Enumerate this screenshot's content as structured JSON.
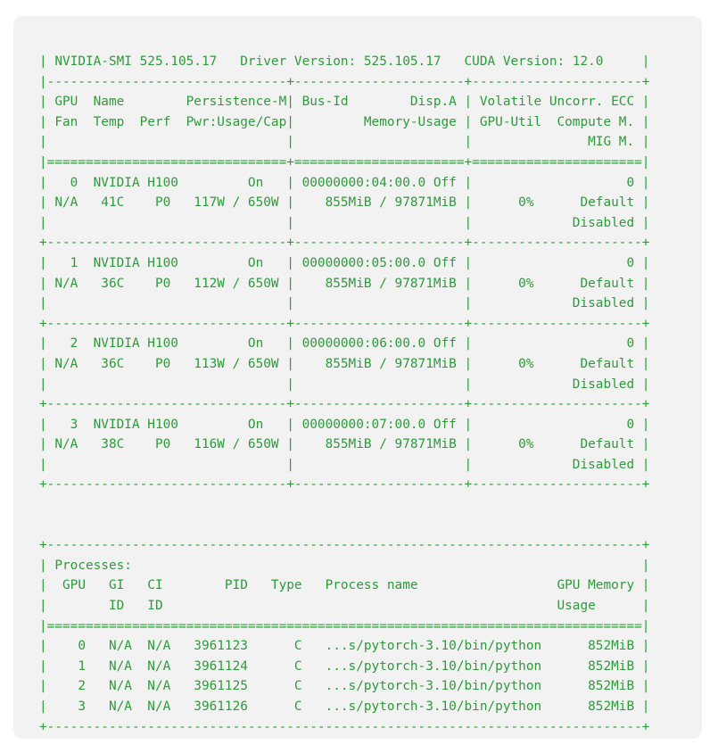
{
  "smi": {
    "version_line": "| NVIDIA-SMI 525.105.17   Driver Version: 525.105.17   CUDA Version: 12.0     |",
    "gpu_table": {
      "top_border": "|-------------------------------+----------------------+----------------------+",
      "header_rows": [
        "| GPU  Name        Persistence-M| Bus-Id        Disp.A | Volatile Uncorr. ECC |",
        "| Fan  Temp  Perf  Pwr:Usage/Cap|         Memory-Usage | GPU-Util  Compute M. |",
        "|                               |                      |               MIG M. |"
      ],
      "header_separator": "|===============================+======================+======================|",
      "gpus": [
        {
          "rows": [
            "|   0  NVIDIA H100         On   | 00000000:04:00.0 Off |                    0 |",
            "| N/A   41C    P0   117W / 650W |    855MiB / 97871MiB |      0%      Default |",
            "|                               |                      |             Disabled |"
          ],
          "separator": "+-------------------------------+----------------------+----------------------+"
        },
        {
          "rows": [
            "|   1  NVIDIA H100         On   | 00000000:05:00.0 Off |                    0 |",
            "| N/A   36C    P0   112W / 650W |    855MiB / 97871MiB |      0%      Default |",
            "|                               |                      |             Disabled |"
          ],
          "separator": "+-------------------------------+----------------------+----------------------+"
        },
        {
          "rows": [
            "|   2  NVIDIA H100         On   | 00000000:06:00.0 Off |                    0 |",
            "| N/A   36C    P0   113W / 650W |    855MiB / 97871MiB |      0%      Default |",
            "|                               |                      |             Disabled |"
          ],
          "separator": "+-------------------------------+----------------------+----------------------+"
        },
        {
          "rows": [
            "|   3  NVIDIA H100         On   | 00000000:07:00.0 Off |                    0 |",
            "| N/A   38C    P0   116W / 650W |    855MiB / 97871MiB |      0%      Default |",
            "|                               |                      |             Disabled |"
          ],
          "separator": "+-------------------------------+----------------------+----------------------+"
        }
      ]
    },
    "processes": {
      "top_border": "+-----------------------------------------------------------------------------+",
      "title_row": "| Processes:                                                                  |",
      "header_rows": [
        "|  GPU   GI   CI        PID   Type   Process name                  GPU Memory |",
        "|        ID   ID                                                   Usage      |"
      ],
      "header_separator": "|=============================================================================|",
      "rows": [
        "|    0   N/A  N/A   3961123      C   ...s/pytorch-3.10/bin/python      852MiB |",
        "|    1   N/A  N/A   3961124      C   ...s/pytorch-3.10/bin/python      852MiB |",
        "|    2   N/A  N/A   3961125      C   ...s/pytorch-3.10/bin/python      852MiB |",
        "|    3   N/A  N/A   3961126      C   ...s/pytorch-3.10/bin/python      852MiB |"
      ],
      "bottom_border": "+-----------------------------------------------------------------------------+"
    }
  }
}
